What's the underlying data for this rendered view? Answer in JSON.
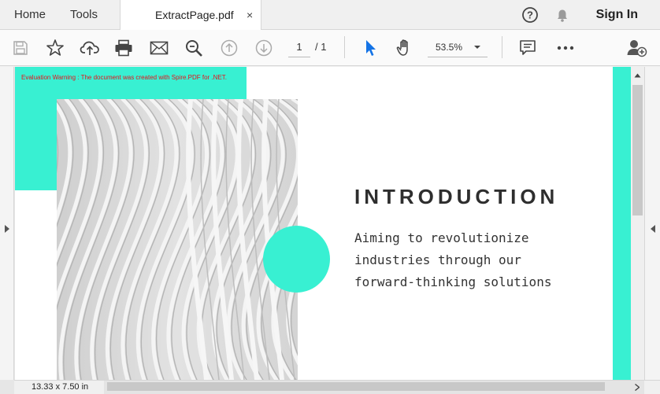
{
  "tabs": {
    "home": "Home",
    "tools": "Tools",
    "file": "ExtractPage.pdf",
    "close": "×"
  },
  "header": {
    "signin": "Sign In"
  },
  "toolbar": {
    "page_current": "1",
    "page_total": "/ 1",
    "zoom": "53.5%"
  },
  "status": {
    "page_size": "13.33 x 7.50 in"
  },
  "document": {
    "warning": "Evaluation Warning : The document was created with Spire.PDF for .NET.",
    "title": "INTRODUCTION",
    "body_lines": [
      "Aiming to revolutionize",
      "industries through our",
      "forward-thinking solutions"
    ]
  },
  "colors": {
    "accent": "#38f0d2",
    "warning": "#e8101a",
    "select_tool": "#1473e6"
  },
  "icons": [
    "save-icon",
    "bookmark-star-icon",
    "upload-cloud-icon",
    "print-icon",
    "mail-icon",
    "zoom-search-icon",
    "page-up-icon",
    "page-down-icon",
    "select-cursor-icon",
    "hand-tool-icon",
    "comment-icon",
    "more-icon",
    "add-user-icon",
    "help-icon",
    "bell-icon"
  ]
}
